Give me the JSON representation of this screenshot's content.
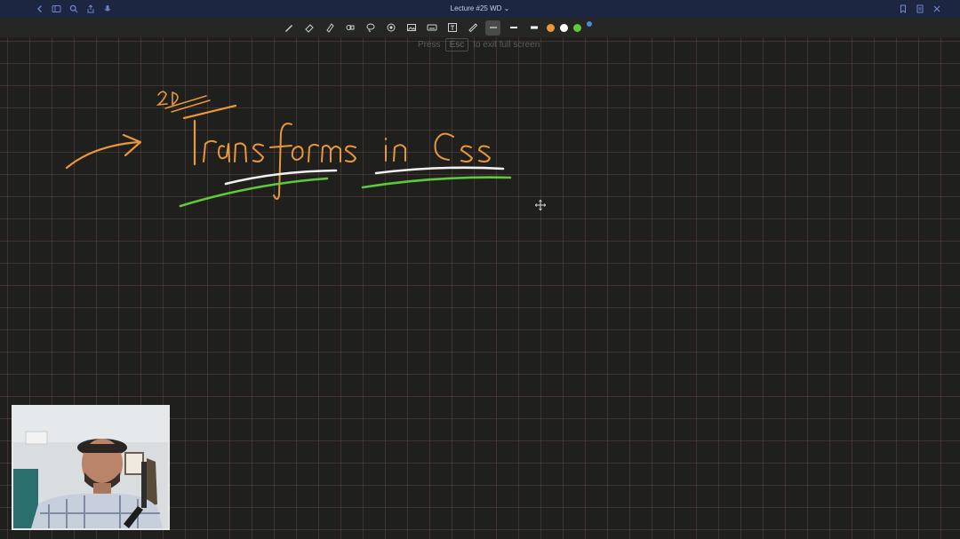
{
  "window": {
    "title": "Lecture #25 WD ⌄"
  },
  "titlebar_left_icons": [
    "back-icon",
    "sidebar-icon",
    "search-icon",
    "share-icon",
    "mic-icon"
  ],
  "titlebar_right_icons": [
    "bookmark-icon",
    "page-icon",
    "close-icon"
  ],
  "toolbar": {
    "tools": [
      "pen-icon",
      "eraser-icon",
      "highlighter-icon",
      "shapes-icon",
      "lasso-icon",
      "laser-icon",
      "image-icon",
      "keyboard-icon",
      "text-icon",
      "ruler-icon"
    ],
    "stroke_widths": [
      "thin",
      "medium",
      "thick"
    ],
    "active_stroke": "thin",
    "colors": [
      "#e8973a",
      "#ffffff",
      "#5fc93b",
      "#4d8ad9"
    ]
  },
  "fullscreen_hint": {
    "prefix": "Press",
    "key": "Esc",
    "suffix": "to exit full screen"
  },
  "canvas": {
    "handwriting": "Transforms in Css",
    "superscript": "2D",
    "ink_colors": {
      "text": "#e8973a",
      "underline_white": "#f2f2f2",
      "underline_green": "#5fc93b"
    }
  },
  "webcam": {
    "description": "presenter video feed"
  }
}
